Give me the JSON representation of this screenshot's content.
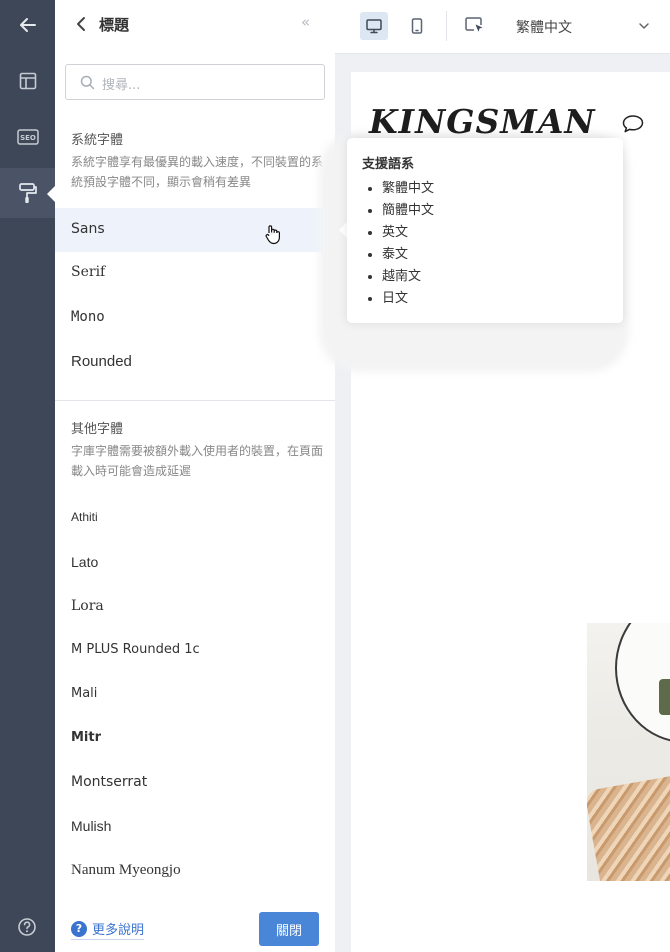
{
  "rail": {
    "items": [
      "back",
      "layout",
      "seo",
      "style",
      "help"
    ],
    "active": "style"
  },
  "panel": {
    "title": "標題",
    "collapse_glyph": "«",
    "search_placeholder": "搜尋...",
    "system_section": {
      "title": "系統字體",
      "description": "系統字體享有最優異的載入速度，不同裝置的系統預設字體不同，顯示會稍有差異",
      "fonts": [
        "Sans",
        "Serif",
        "Mono",
        "Rounded"
      ]
    },
    "other_section": {
      "title": "其他字體",
      "description": "字庫字體需要被額外載入使用者的裝置，在頁面載入時可能會造成延遲",
      "fonts": [
        "Athiti",
        "Lato",
        "Lora",
        "M PLUS Rounded 1c",
        "Mali",
        "Mitr",
        "Montserrat",
        "Mulish",
        "Nanum Myeongjo"
      ]
    },
    "help_label": "更多說明",
    "close_label": "關閉"
  },
  "toolbar": {
    "language": "繁體中文"
  },
  "tooltip": {
    "title": "支援語系",
    "languages": [
      "繁體中文",
      "簡體中文",
      "英文",
      "泰文",
      "越南文",
      "日文"
    ]
  },
  "preview": {
    "logo_text": "KINGSMAN"
  },
  "colors": {
    "rail_bg": "#3d4757",
    "accent": "#4a86d8",
    "hover_row": "#eef3fb"
  }
}
